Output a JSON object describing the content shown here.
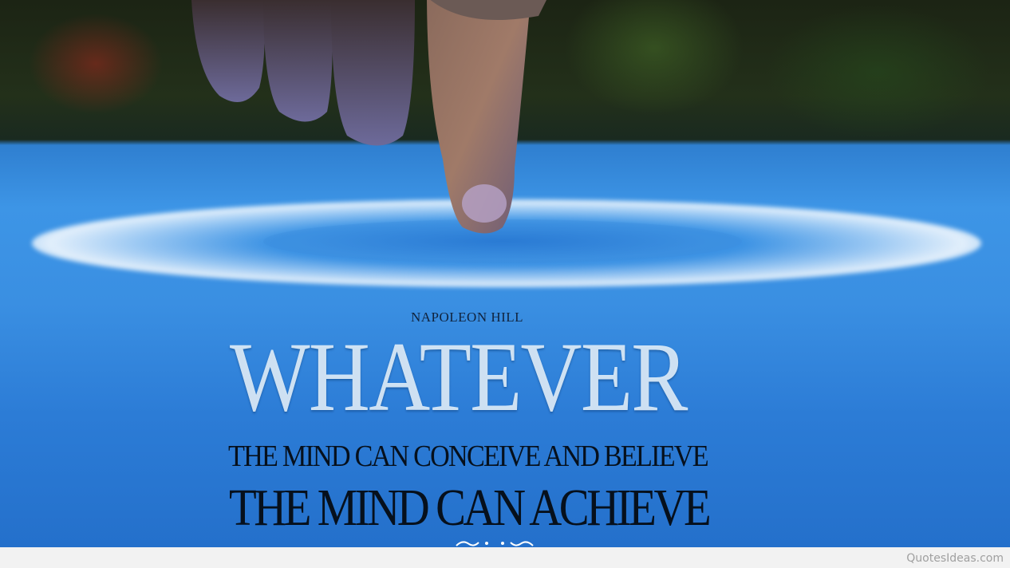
{
  "quote": {
    "author": "NAPOLEON HILL",
    "headline": "WHATEVER",
    "line_one": "THE MIND CAN CONCEIVE AND BELIEVE",
    "line_two": "THE MIND CAN ACHIEVE"
  },
  "footer": {
    "watermark": "QuotesIdeas.com"
  },
  "icons": {
    "ornament": "flourish-ornament-icon"
  },
  "colors": {
    "water_blue": "#3d95e6",
    "text_dark": "#06101c",
    "headline_light": "#e1eefa"
  }
}
